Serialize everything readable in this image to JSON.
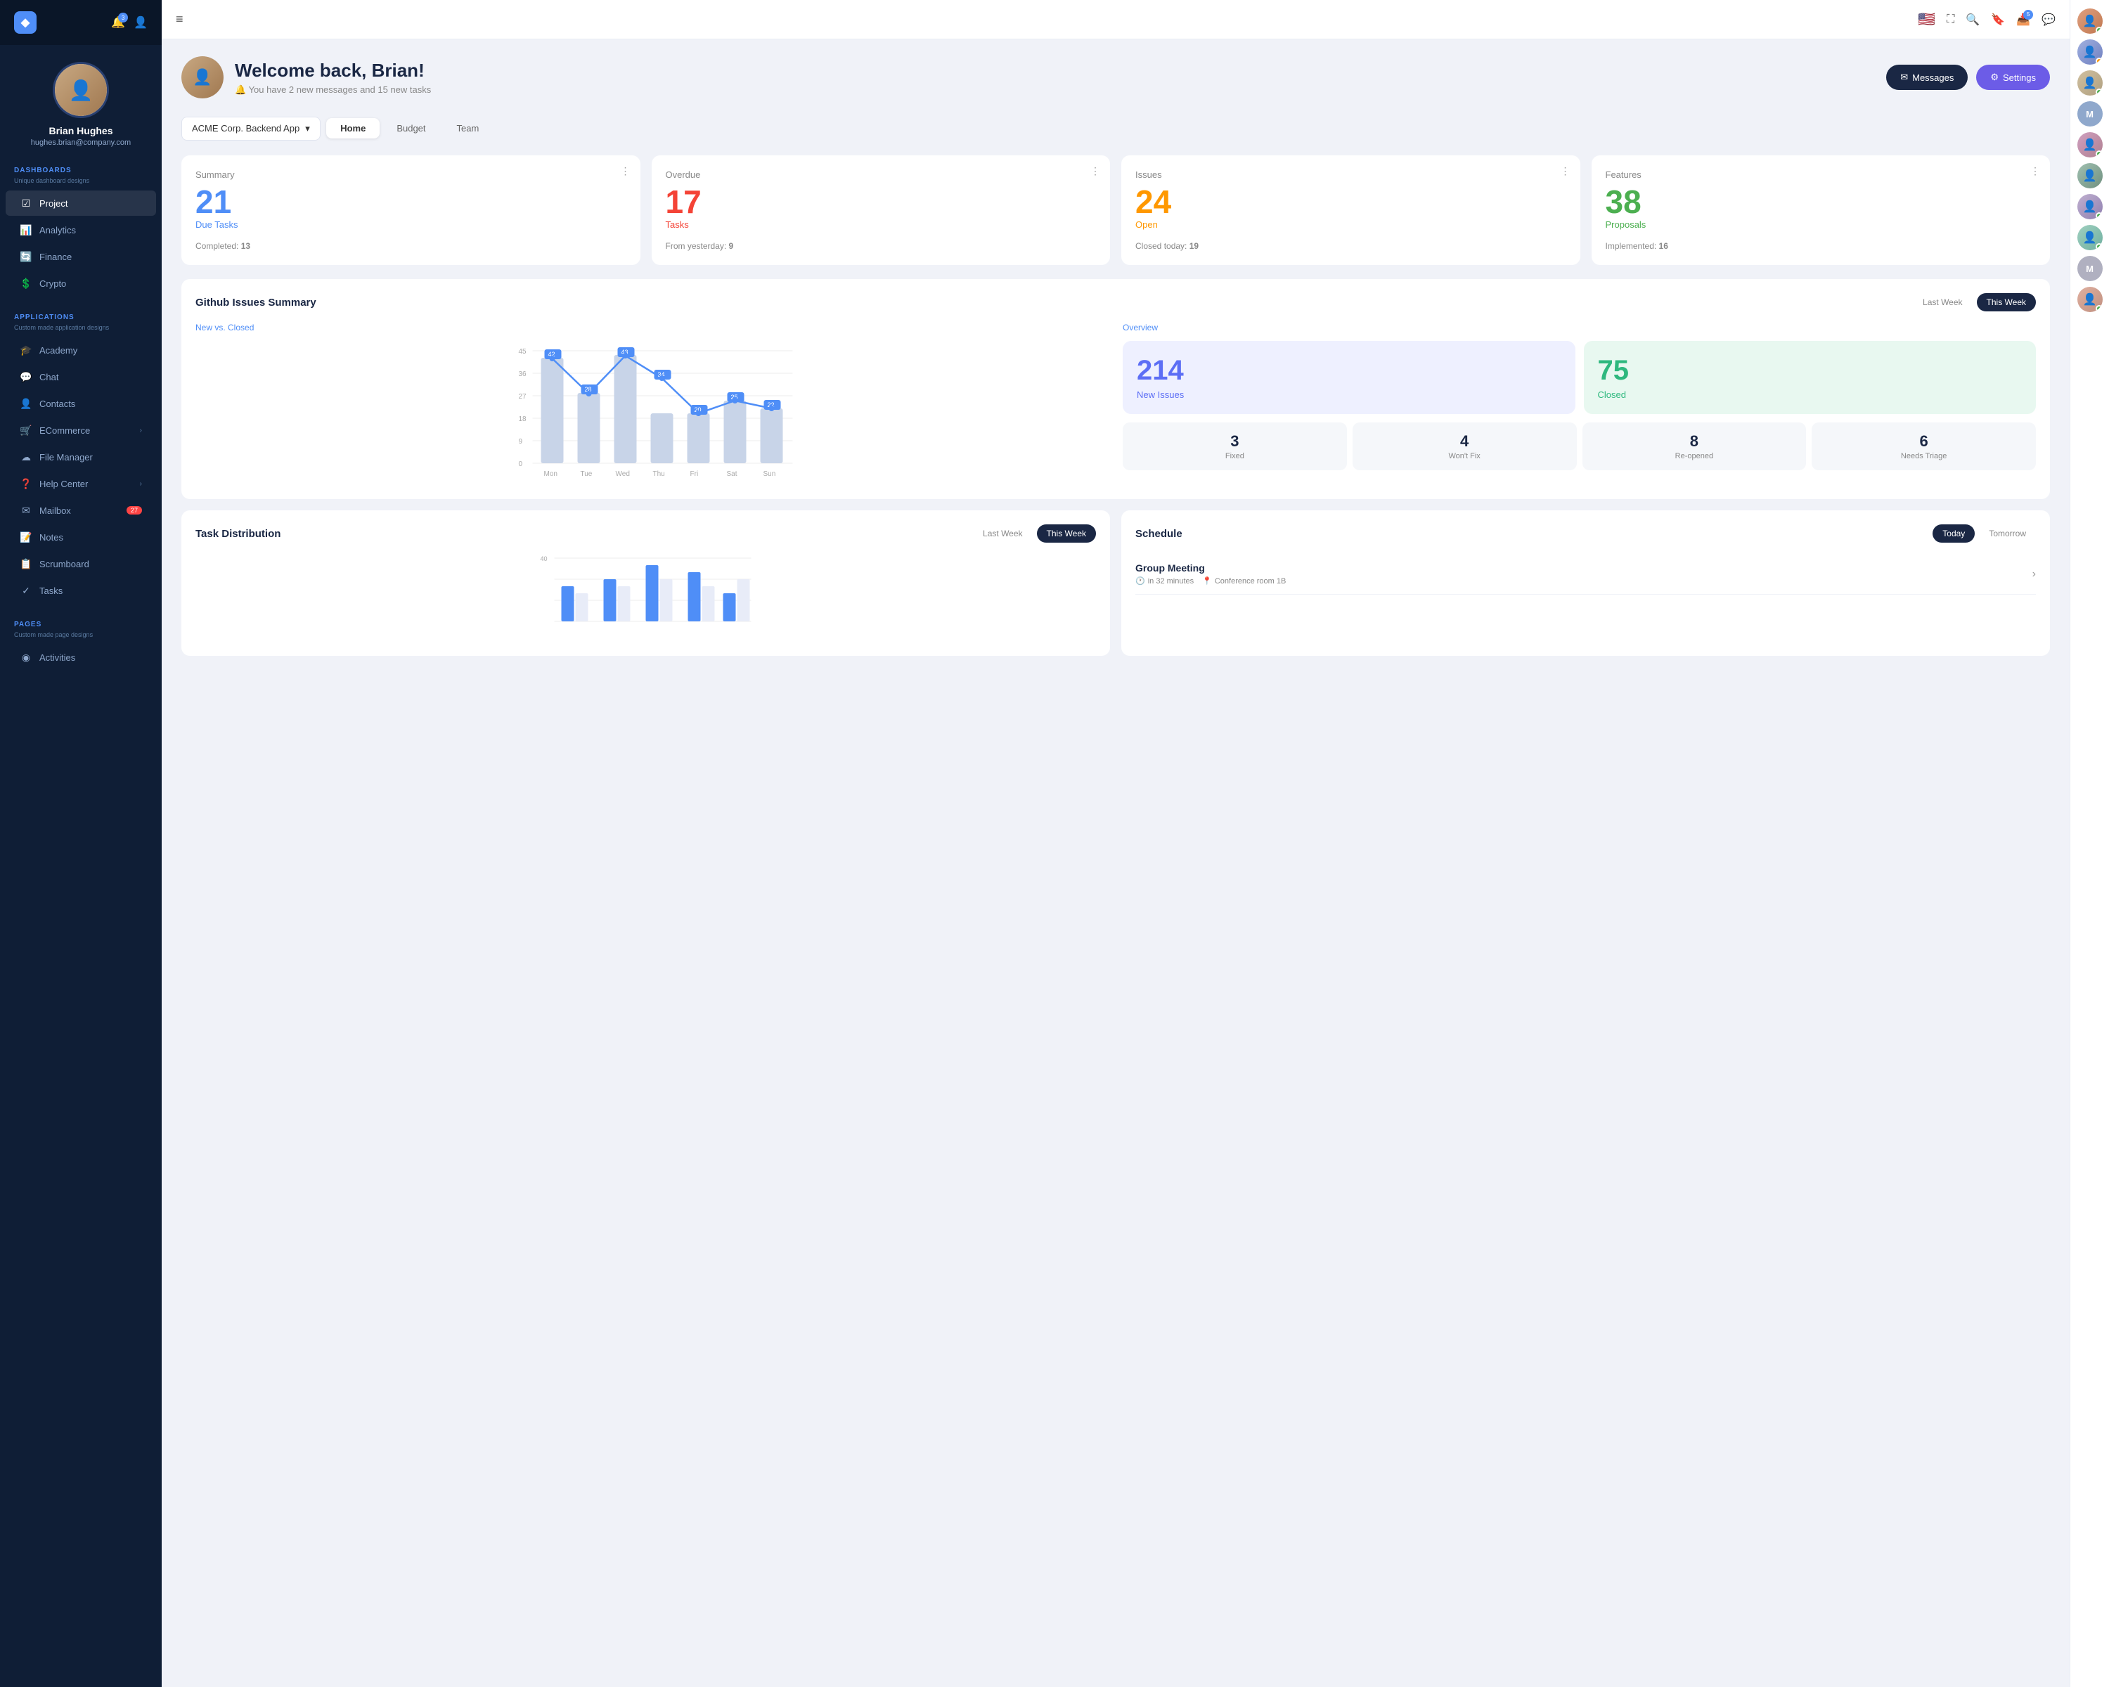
{
  "sidebar": {
    "logo_text": "◆",
    "user": {
      "name": "Brian Hughes",
      "email": "hughes.brian@company.com"
    },
    "notifications_count": "3",
    "dashboards": {
      "label": "DASHBOARDS",
      "sublabel": "Unique dashboard designs",
      "items": [
        {
          "id": "project",
          "label": "Project",
          "icon": "☑",
          "active": true
        },
        {
          "id": "analytics",
          "label": "Analytics",
          "icon": "📊"
        },
        {
          "id": "finance",
          "label": "Finance",
          "icon": "🔄"
        },
        {
          "id": "crypto",
          "label": "Crypto",
          "icon": "💲"
        }
      ]
    },
    "applications": {
      "label": "APPLICATIONS",
      "sublabel": "Custom made application designs",
      "items": [
        {
          "id": "academy",
          "label": "Academy",
          "icon": "🎓"
        },
        {
          "id": "chat",
          "label": "Chat",
          "icon": "💬"
        },
        {
          "id": "contacts",
          "label": "Contacts",
          "icon": "👤"
        },
        {
          "id": "ecommerce",
          "label": "ECommerce",
          "icon": "🛒",
          "arrow": true
        },
        {
          "id": "file-manager",
          "label": "File Manager",
          "icon": "☁"
        },
        {
          "id": "help-center",
          "label": "Help Center",
          "icon": "❓",
          "arrow": true
        },
        {
          "id": "mailbox",
          "label": "Mailbox",
          "icon": "✉",
          "badge": "27"
        },
        {
          "id": "notes",
          "label": "Notes",
          "icon": "📝"
        },
        {
          "id": "scrumboard",
          "label": "Scrumboard",
          "icon": "📋"
        },
        {
          "id": "tasks",
          "label": "Tasks",
          "icon": "✓"
        }
      ]
    },
    "pages": {
      "label": "PAGES",
      "sublabel": "Custom made page designs",
      "items": [
        {
          "id": "activities",
          "label": "Activities",
          "icon": "◉"
        }
      ]
    }
  },
  "topbar": {
    "hamburger": "≡",
    "icons": [
      "🏳",
      "⛶",
      "🔍",
      "🔖"
    ],
    "inbox_count": "5",
    "chat_icon": "💬"
  },
  "welcome": {
    "greeting": "Welcome back, Brian!",
    "message": "🔔 You have 2 new messages and 15 new tasks",
    "btn_messages": "Messages",
    "btn_settings": "Settings"
  },
  "project_selector": {
    "label": "ACME Corp. Backend App"
  },
  "tabs": [
    {
      "id": "home",
      "label": "Home",
      "active": true
    },
    {
      "id": "budget",
      "label": "Budget"
    },
    {
      "id": "team",
      "label": "Team"
    }
  ],
  "stats": [
    {
      "title": "Summary",
      "number": "21",
      "label": "Due Tasks",
      "color": "blue",
      "secondary": "Completed:",
      "secondary_val": "13"
    },
    {
      "title": "Overdue",
      "number": "17",
      "label": "Tasks",
      "color": "red",
      "secondary": "From yesterday:",
      "secondary_val": "9"
    },
    {
      "title": "Issues",
      "number": "24",
      "label": "Open",
      "color": "orange",
      "secondary": "Closed today:",
      "secondary_val": "19"
    },
    {
      "title": "Features",
      "number": "38",
      "label": "Proposals",
      "color": "green",
      "secondary": "Implemented:",
      "secondary_val": "16"
    }
  ],
  "github_chart": {
    "title": "Github Issues Summary",
    "last_week": "Last Week",
    "this_week": "This Week",
    "subtitle": "New vs. Closed",
    "chart_data": {
      "labels": [
        "Mon",
        "Tue",
        "Wed",
        "Thu",
        "Fri",
        "Sat",
        "Sun"
      ],
      "bar_values": [
        42,
        28,
        43,
        20,
        20,
        25,
        22
      ],
      "line_values": [
        42,
        28,
        43,
        34,
        20,
        25,
        22
      ],
      "y_max": 45,
      "y_labels": [
        "45",
        "36",
        "27",
        "18",
        "9",
        "0"
      ]
    },
    "overview_label": "Overview",
    "new_issues": "214",
    "new_issues_label": "New Issues",
    "closed": "75",
    "closed_label": "Closed",
    "mini_stats": [
      {
        "num": "3",
        "label": "Fixed"
      },
      {
        "num": "4",
        "label": "Won't Fix"
      },
      {
        "num": "8",
        "label": "Re-opened"
      },
      {
        "num": "6",
        "label": "Needs Triage"
      }
    ]
  },
  "task_distribution": {
    "title": "Task Distribution",
    "last_week": "Last Week",
    "this_week": "This Week"
  },
  "schedule": {
    "title": "Schedule",
    "today": "Today",
    "tomorrow": "Tomorrow",
    "items": [
      {
        "title": "Group Meeting",
        "time": "in 32 minutes",
        "location": "Conference room 1B"
      }
    ]
  },
  "right_panel": {
    "avatars": [
      {
        "color": "#e0a0a0",
        "initial": "",
        "online": true
      },
      {
        "color": "#a0b0e0",
        "initial": "",
        "online": false
      },
      {
        "color": "#c0d0a0",
        "initial": "",
        "online": true
      },
      {
        "color": "#b0b0b0",
        "initial": "M",
        "bg": "#8fa8cc"
      },
      {
        "color": "#d0a0c0",
        "initial": "",
        "online": true
      },
      {
        "color": "#a0c0d0",
        "initial": "",
        "online": false
      },
      {
        "color": "#e0c0a0",
        "initial": "",
        "online": true
      },
      {
        "color": "#b0e0b0",
        "initial": "",
        "online": true
      },
      {
        "color": "#d0b0e0",
        "initial": "",
        "online": false
      },
      {
        "color": "#a0e0d0",
        "initial": "",
        "online": true
      },
      {
        "color": "#b0b0b0",
        "initial": "M",
        "bg": "#8fa8cc"
      },
      {
        "color": "#e0a0b0",
        "initial": "",
        "online": true
      }
    ]
  }
}
